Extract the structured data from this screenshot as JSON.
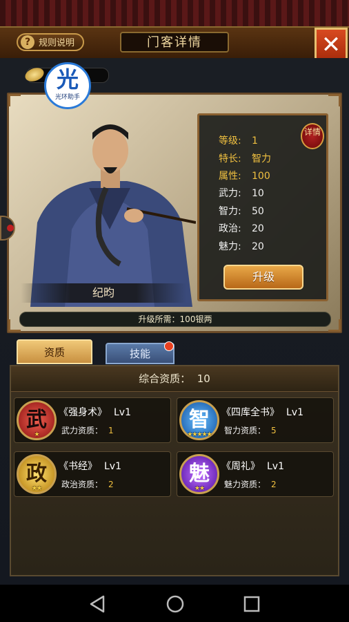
{
  "header": {
    "rules_label": "规则说明",
    "rules_icon": "?",
    "title": "门客详情",
    "close_icon": "close-x-icon"
  },
  "helper_badge": {
    "glyph": "光",
    "label": "光环助手"
  },
  "hero": {
    "name": "纪昀",
    "upgrade_cost": "升级所需：100银两",
    "detail_seal": "详情"
  },
  "stats": [
    {
      "label": "等级:",
      "value": "1",
      "highlight": true
    },
    {
      "label": "特长:",
      "value": "智力",
      "highlight": true
    },
    {
      "label": "属性:",
      "value": "100",
      "highlight": true
    },
    {
      "label": "武力:",
      "value": "10",
      "highlight": false
    },
    {
      "label": "智力:",
      "value": "50",
      "highlight": false
    },
    {
      "label": "政治:",
      "value": "20",
      "highlight": false
    },
    {
      "label": "魅力:",
      "value": "20",
      "highlight": false
    }
  ],
  "upgrade_label": "升级",
  "tabs": [
    {
      "label": "资质",
      "active": true
    },
    {
      "label": "技能",
      "active": false,
      "has_notification": true
    }
  ],
  "qualities": {
    "total_label": "综合资质：",
    "total_value": "10",
    "skills": [
      {
        "glyph": "武",
        "title": "《强身术》",
        "level": "Lv1",
        "attr_label": "武力资质：",
        "attr_value": "1",
        "stars": 1,
        "color": "red"
      },
      {
        "glyph": "智",
        "title": "《四库全书》",
        "level": "Lv1",
        "attr_label": "智力资质：",
        "attr_value": "5",
        "stars": 5,
        "color": "blue"
      },
      {
        "glyph": "政",
        "title": "《书经》",
        "level": "Lv1",
        "attr_label": "政治资质：",
        "attr_value": "2",
        "stars": 2,
        "color": "gold"
      },
      {
        "glyph": "魅",
        "title": "《周礼》",
        "level": "Lv1",
        "attr_label": "魅力资质：",
        "attr_value": "2",
        "stars": 2,
        "color": "purple"
      }
    ]
  },
  "nav": [
    "back-icon",
    "home-icon",
    "recents-icon"
  ]
}
